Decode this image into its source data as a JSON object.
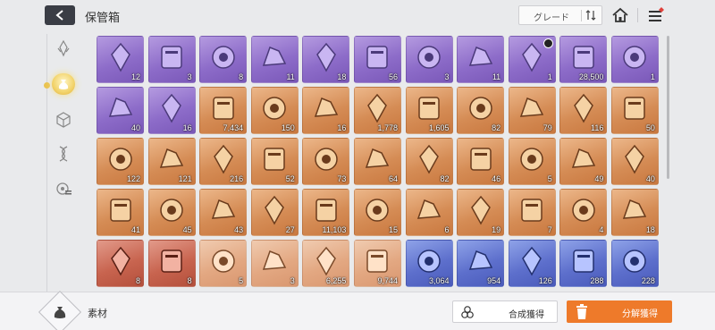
{
  "header": {
    "title": "保管箱",
    "grade_label": "グレード",
    "sort_icon": "sort-toggle-icon"
  },
  "sidebar": {
    "items": [
      {
        "icon": "crystal-icon",
        "active": false
      },
      {
        "icon": "pouch-icon",
        "active": true
      },
      {
        "icon": "cube-icon",
        "active": false
      },
      {
        "icon": "dna-icon",
        "active": false
      },
      {
        "icon": "gear-list-icon",
        "active": false
      }
    ]
  },
  "inventory": {
    "items": [
      {
        "name": "tarot-card",
        "rarity": "purple",
        "qty": "12"
      },
      {
        "name": "tree-card",
        "rarity": "purple",
        "qty": "3"
      },
      {
        "name": "helmet-head",
        "rarity": "purple",
        "qty": "8"
      },
      {
        "name": "brain-coral",
        "rarity": "purple",
        "qty": "11"
      },
      {
        "name": "eye-orb",
        "rarity": "purple",
        "qty": "18"
      },
      {
        "name": "rock-golem",
        "rarity": "purple",
        "qty": "56"
      },
      {
        "name": "stone-head",
        "rarity": "purple",
        "qty": "3"
      },
      {
        "name": "red-geode",
        "rarity": "purple",
        "qty": "11"
      },
      {
        "name": "warning-triangle",
        "rarity": "purple",
        "qty": "1",
        "timer": true
      },
      {
        "name": "crystal-heart",
        "rarity": "purple",
        "qty": "28,500"
      },
      {
        "name": "amethyst-cluster",
        "rarity": "purple",
        "qty": "1"
      },
      {
        "name": "dark-shell",
        "rarity": "purple",
        "qty": "40"
      },
      {
        "name": "puzzle-piece",
        "rarity": "purple",
        "qty": "16"
      },
      {
        "name": "blue-slime",
        "rarity": "orange",
        "qty": "7,434"
      },
      {
        "name": "dark-chip",
        "rarity": "orange",
        "qty": "150"
      },
      {
        "name": "teal-orb",
        "rarity": "orange",
        "qty": "16"
      },
      {
        "name": "gold-ticket",
        "rarity": "orange",
        "qty": "1,778"
      },
      {
        "name": "gold-ticket-2",
        "rarity": "orange",
        "qty": "1,605"
      },
      {
        "name": "purple-eye",
        "rarity": "orange",
        "qty": "82"
      },
      {
        "name": "moon-sparkle",
        "rarity": "orange",
        "qty": "79"
      },
      {
        "name": "pink-crystal",
        "rarity": "orange",
        "qty": "116"
      },
      {
        "name": "orange-crystal",
        "rarity": "orange",
        "qty": "50"
      },
      {
        "name": "purple-crystal",
        "rarity": "orange",
        "qty": "122"
      },
      {
        "name": "green-crystal",
        "rarity": "orange",
        "qty": "121"
      },
      {
        "name": "blue-crystal",
        "rarity": "orange",
        "qty": "216"
      },
      {
        "name": "book-x",
        "rarity": "orange",
        "qty": "52"
      },
      {
        "name": "book-shield",
        "rarity": "orange",
        "qty": "73"
      },
      {
        "name": "book-eye",
        "rarity": "orange",
        "qty": "64"
      },
      {
        "name": "book-arrow",
        "rarity": "orange",
        "qty": "82"
      },
      {
        "name": "book-cross",
        "rarity": "orange",
        "qty": "46"
      },
      {
        "name": "book-target",
        "rarity": "orange",
        "qty": "5"
      },
      {
        "name": "compass-medal",
        "rarity": "orange",
        "qty": "49"
      },
      {
        "name": "shield-medal",
        "rarity": "orange",
        "qty": "40"
      },
      {
        "name": "star-medal",
        "rarity": "orange",
        "qty": "41"
      },
      {
        "name": "sun-medal",
        "rarity": "orange",
        "qty": "45"
      },
      {
        "name": "fire-medal",
        "rarity": "orange",
        "qty": "43"
      },
      {
        "name": "globe-medal",
        "rarity": "orange",
        "qty": "27"
      },
      {
        "name": "gold-leaves",
        "rarity": "orange",
        "qty": "11,103"
      },
      {
        "name": "blue-cube",
        "rarity": "orange",
        "qty": "15"
      },
      {
        "name": "sneakers",
        "rarity": "orange",
        "qty": "6"
      },
      {
        "name": "star-book",
        "rarity": "orange",
        "qty": "19"
      },
      {
        "name": "glass-flask",
        "rarity": "orange",
        "qty": "7"
      },
      {
        "name": "photo-cards",
        "rarity": "orange",
        "qty": "4"
      },
      {
        "name": "envelope",
        "rarity": "orange",
        "qty": "18"
      },
      {
        "name": "dreamcatcher",
        "rarity": "red",
        "qty": "8"
      },
      {
        "name": "leather-book",
        "rarity": "red",
        "qty": "8"
      },
      {
        "name": "opal-drop",
        "rarity": "peach",
        "qty": "5"
      },
      {
        "name": "tree-scroll",
        "rarity": "peach",
        "qty": "3"
      },
      {
        "name": "sea-urchin",
        "rarity": "peach",
        "qty": "6,255"
      },
      {
        "name": "crystal-shards",
        "rarity": "peach",
        "qty": "9,744"
      },
      {
        "name": "silver-ticket",
        "rarity": "blue",
        "qty": "3,064"
      },
      {
        "name": "silver-ticket-2",
        "rarity": "blue",
        "qty": "954"
      },
      {
        "name": "red-shard",
        "rarity": "blue",
        "qty": "126"
      },
      {
        "name": "amber-shard",
        "rarity": "blue",
        "qty": "288"
      },
      {
        "name": "violet-shard",
        "rarity": "blue",
        "qty": "228"
      }
    ]
  },
  "footer": {
    "category_label": "素材",
    "synth_label": "合成獲得",
    "decomp_label": "分解獲得"
  },
  "colors": {
    "accent_orange": "#ee7a2a",
    "purple_rarity": "#8d6cc9",
    "orange_rarity": "#d58c55",
    "blue_rarity": "#5d6fcc"
  }
}
